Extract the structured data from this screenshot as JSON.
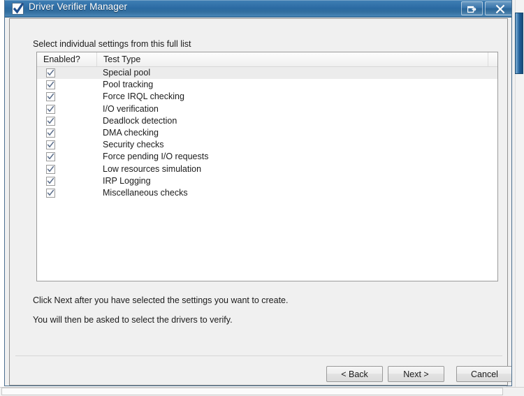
{
  "window": {
    "title": "Driver Verifier Manager",
    "icon": "checkmark-document-icon",
    "controls": {
      "restore_label": "Restore",
      "close_label": "Close"
    },
    "accent_color": "#2a6aa2",
    "title_text_color": "#ffffff"
  },
  "content": {
    "instruction": "Select individual settings from this full list",
    "footer_line_1": "Click Next after you have selected the settings you want to create.",
    "footer_line_2": "You will then be asked to select the drivers to verify."
  },
  "listview": {
    "columns": [
      {
        "label": "Enabled?"
      },
      {
        "label": "Test Type"
      },
      {
        "label": ""
      }
    ],
    "rows": [
      {
        "enabled": true,
        "test_type": "Special pool",
        "selected": true
      },
      {
        "enabled": true,
        "test_type": "Pool tracking",
        "selected": false
      },
      {
        "enabled": true,
        "test_type": "Force IRQL checking",
        "selected": false
      },
      {
        "enabled": true,
        "test_type": "I/O verification",
        "selected": false
      },
      {
        "enabled": true,
        "test_type": "Deadlock detection",
        "selected": false
      },
      {
        "enabled": true,
        "test_type": "DMA checking",
        "selected": false
      },
      {
        "enabled": true,
        "test_type": "Security checks",
        "selected": false
      },
      {
        "enabled": true,
        "test_type": "Force pending I/O requests",
        "selected": false
      },
      {
        "enabled": true,
        "test_type": "Low resources simulation",
        "selected": false
      },
      {
        "enabled": true,
        "test_type": "IRP Logging",
        "selected": false
      },
      {
        "enabled": true,
        "test_type": "Miscellaneous checks",
        "selected": false
      }
    ]
  },
  "buttons": {
    "back": "< Back",
    "next": "Next >",
    "cancel": "Cancel"
  }
}
